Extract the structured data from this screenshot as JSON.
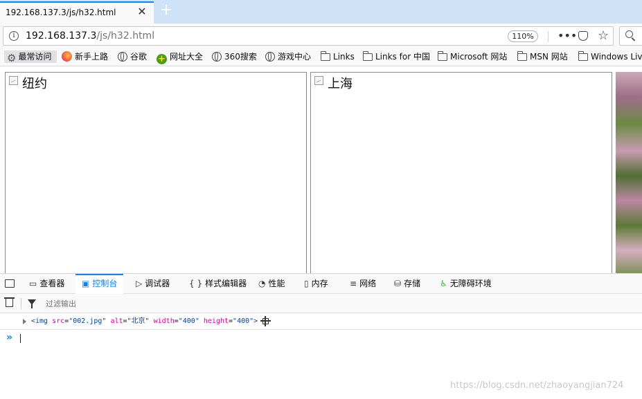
{
  "tab": {
    "title": "192.168.137.3/js/h32.html",
    "close": "✕",
    "new": "+"
  },
  "urlbar": {
    "host": "192.168.137.3",
    "path": "/js/h32.html",
    "zoom": "110%",
    "dots": "•••",
    "star": "☆"
  },
  "bookmarks": [
    {
      "label": "最常访问",
      "icon": "gear-icon"
    },
    {
      "label": "新手上路",
      "icon": "firefox-icon"
    },
    {
      "label": "谷歌",
      "icon": "globe-icon"
    },
    {
      "label": "网址大全",
      "icon": "wzdq-icon"
    },
    {
      "label": "360搜索",
      "icon": "globe-icon"
    },
    {
      "label": "游戏中心",
      "icon": "globe-icon"
    },
    {
      "label": "Links",
      "icon": "folder-icon"
    },
    {
      "label": "Links for 中国",
      "icon": "folder-icon"
    },
    {
      "label": "Microsoft 网站",
      "icon": "folder-icon"
    },
    {
      "label": "MSN 网站",
      "icon": "folder-icon"
    },
    {
      "label": "Windows Liv",
      "icon": "folder-icon"
    }
  ],
  "page": {
    "images": [
      {
        "alt": "纽约"
      },
      {
        "alt": "上海"
      }
    ]
  },
  "devtools": {
    "tabs": [
      {
        "label": "查看器",
        "icon": "inspector-icon"
      },
      {
        "label": "控制台",
        "icon": "console-icon",
        "active": true
      },
      {
        "label": "调试器",
        "icon": "debugger-icon"
      },
      {
        "label": "样式编辑器",
        "icon": "style-editor-icon"
      },
      {
        "label": "性能",
        "icon": "performance-icon"
      },
      {
        "label": "内存",
        "icon": "memory-icon"
      },
      {
        "label": "网络",
        "icon": "network-icon"
      },
      {
        "label": "存储",
        "icon": "storage-icon"
      },
      {
        "label": "无障碍环境",
        "icon": "accessibility-icon"
      }
    ],
    "filter_placeholder": "过滤输出",
    "log": {
      "open": "<img",
      "src_attr": "src",
      "src_val": "\"002.jpg\"",
      "alt_attr": "alt",
      "alt_val": "\"北京\"",
      "width_attr": "width",
      "width_val": "\"400\"",
      "height_attr": "height",
      "height_val": "\"400\"",
      "close": ">"
    },
    "prompt": "»"
  },
  "watermark": "https://blog.csdn.net/zhaoyangjian724"
}
